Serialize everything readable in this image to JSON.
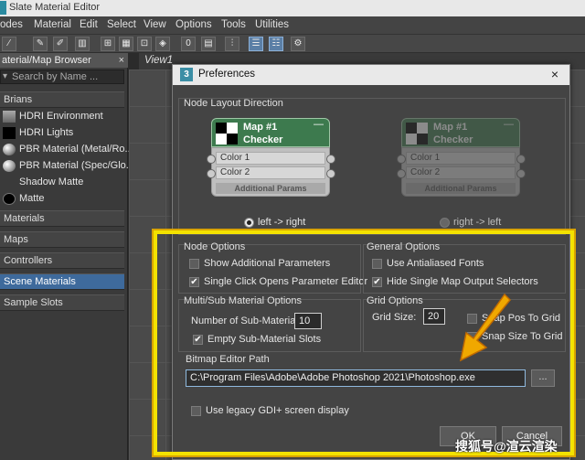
{
  "app": {
    "title": "Slate Material Editor"
  },
  "menu": [
    "odes",
    "Material",
    "Edit",
    "Select",
    "View",
    "Options",
    "Tools",
    "Utilities"
  ],
  "browser": {
    "title": "aterial/Map Browser",
    "close": "×",
    "search_placeholder": "Search by Name ...",
    "group_label": "Brians",
    "items": [
      {
        "label": "HDRI Environment",
        "icon": "hdri-env-icon"
      },
      {
        "label": "HDRI Lights",
        "icon": "hdri-lights-icon"
      },
      {
        "label": "PBR Material (Metal/Ro...",
        "icon": "sphere-icon"
      },
      {
        "label": "PBR Material (Spec/Glo...",
        "icon": "sphere-icon"
      },
      {
        "label": "Shadow Matte",
        "icon": "shadow-matte-icon"
      },
      {
        "label": "Matte",
        "icon": "matte-icon"
      }
    ],
    "groups": [
      "Materials",
      "Maps",
      "Controllers",
      "Scene Materials",
      "Sample Slots"
    ]
  },
  "view": {
    "tab": "View1"
  },
  "dialog": {
    "title": "Preferences",
    "badge": "3",
    "close": "×",
    "node_layout_caption": "Node Layout Direction",
    "node": {
      "line1": "Map #1",
      "line2": "Checker",
      "port1": "Color 1",
      "port2": "Color 2",
      "params": "Additional Params",
      "min": "—",
      "plus": "+"
    },
    "layout_left_label": "left -> right",
    "layout_right_label": "right -> left",
    "node_options": {
      "caption": "Node Options",
      "show_additional": "Show Additional Parameters",
      "single_click": "Single Click Opens Parameter Editor",
      "show_checked": false,
      "single_checked": true
    },
    "general_options": {
      "caption": "General Options",
      "antialiased": "Use Antialiased Fonts",
      "hide_single": "Hide Single Map Output Selectors",
      "anti_checked": false,
      "hide_checked": true
    },
    "multisub": {
      "caption": "Multi/Sub Material Options",
      "num_label": "Number of Sub-Materials:",
      "num_value": "10",
      "empty_slots": "Empty Sub-Material Slots",
      "empty_checked": true
    },
    "grid": {
      "caption": "Grid Options",
      "size_label": "Grid Size:",
      "size_value": "20",
      "snap_pos": "Snap Pos To Grid",
      "snap_size": "Snap Size To Grid"
    },
    "bitmap": {
      "caption": "Bitmap Editor Path",
      "path": "C:\\Program Files\\Adobe\\Adobe Photoshop 2021\\Photoshop.exe",
      "browse": "..."
    },
    "legacy_gdi": "Use legacy GDI+ screen display",
    "ok": "OK",
    "cancel": "Cancel"
  },
  "highlight_color": "#f3e200",
  "arrow_color": "#f0a800",
  "watermark": "搜狐号@渲云渲染"
}
